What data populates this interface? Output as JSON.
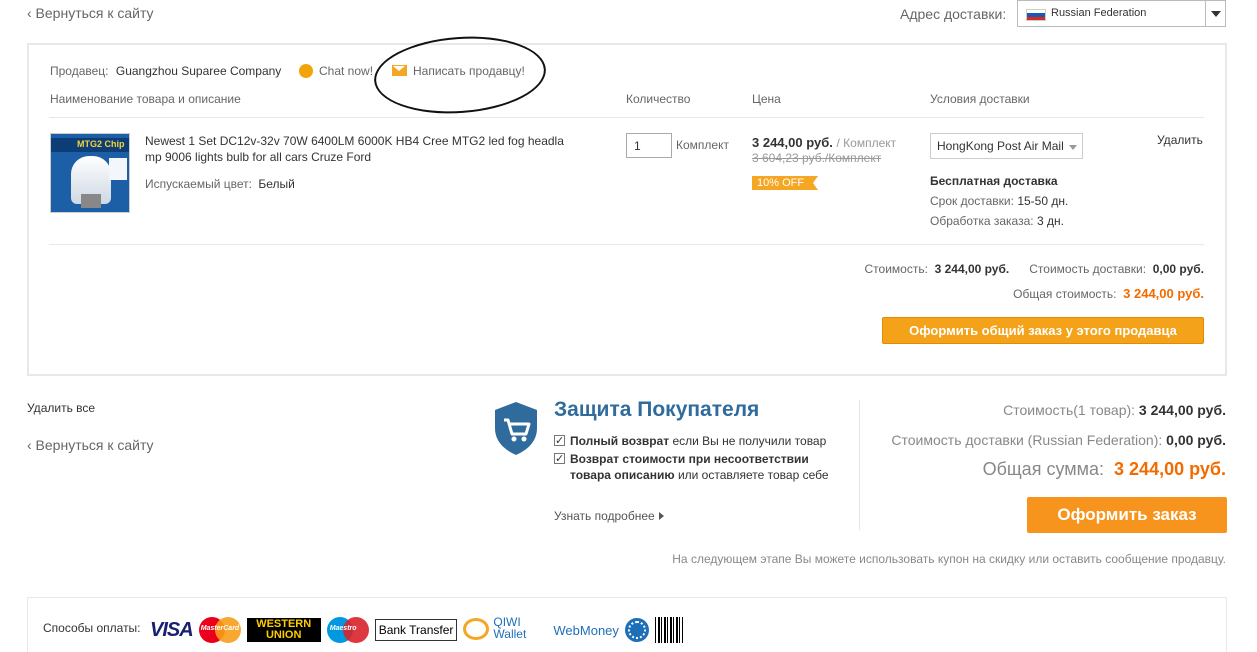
{
  "top": {
    "back_link": "‹ Вернуться к сайту",
    "address_label": "Адрес доставки:",
    "address_value": "Russian Federation",
    "flag_colors": [
      "#ffffff",
      "#1c57b4",
      "#d52b1e"
    ]
  },
  "seller": {
    "label": "Продавец:",
    "name": "Guangzhou Suparee Company",
    "chat_label": "Chat now!",
    "message_label": "Написать продавцу!"
  },
  "table": {
    "headers": {
      "product": "Наименование товара и описание",
      "quantity": "Количество",
      "price": "Цена",
      "shipping": "Условия доставки"
    }
  },
  "item": {
    "image_caption": "MTG2 Chip",
    "title": "Newest 1 Set DC12v-32v 70W 6400LM 6000K HB4 Cree MTG2 led fog headla mp 9006 lights bulb for all cars Cruze Ford",
    "color_label": "Испускаемый цвет:",
    "color_value": "Белый",
    "quantity": "1",
    "unit": "Комплект",
    "price": "3 244,00 руб.",
    "price_per": "/ Комплект",
    "old_price": "3 604,23 руб./Комплект",
    "discount": "10% OFF",
    "shipping_method": "HongKong Post Air Mail",
    "free_shipping": "Бесплатная доставка",
    "delivery_term_label": "Срок доставки:",
    "delivery_term_value": "15-50 дн.",
    "processing_label": "Обработка заказа:",
    "processing_value": "3 дн.",
    "delete_label": "Удалить"
  },
  "seller_summary": {
    "cost_label": "Стоимость:",
    "cost_value": "3 244,00 руб.",
    "shipping_label": "Стоимость доставки:",
    "shipping_value": "0,00 руб.",
    "total_label": "Общая стоимость:",
    "total_value": "3 244,00 руб.",
    "order_button": "Оформить общий заказ у этого продавца"
  },
  "bottom": {
    "delete_all": "Удалить все",
    "back_link": "‹ Вернуться к сайту"
  },
  "protection": {
    "title": "Защита Покупателя",
    "item1_bold": "Полный возврат",
    "item1_rest": " если Вы не получили товар",
    "item2_bold": "Возврат стоимости при несоответствии товара описанию",
    "item2_rest": " или оставляете товар себе",
    "learn_more": "Узнать подробнее"
  },
  "totals": {
    "cost_label": "Стоимость(1 товар):",
    "cost_value": "3 244,00 руб.",
    "shipping_label": "Стоимость доставки (Russian Federation):",
    "shipping_value": "0,00 руб.",
    "total_label": "Общая сумма:",
    "total_value": "3 244,00 руб.",
    "checkout_button": "Оформить заказ",
    "next_step_note": "На следующем этапе Вы можете использовать купон на скидку или оставить сообщение продавцу."
  },
  "payment": {
    "label": "Способы оплаты:",
    "visa": "VISA",
    "mastercard": "MasterCard",
    "western_union": "WESTERN UNION",
    "maestro": "Maestro",
    "bank_transfer": "Bank Transfer",
    "qiwi": "QIWI Wallet",
    "webmoney": "WebMoney"
  },
  "colors": {
    "accent_orange": "#f7941d",
    "price_orange": "#f26b00",
    "protection_blue": "#2f6c9d"
  }
}
